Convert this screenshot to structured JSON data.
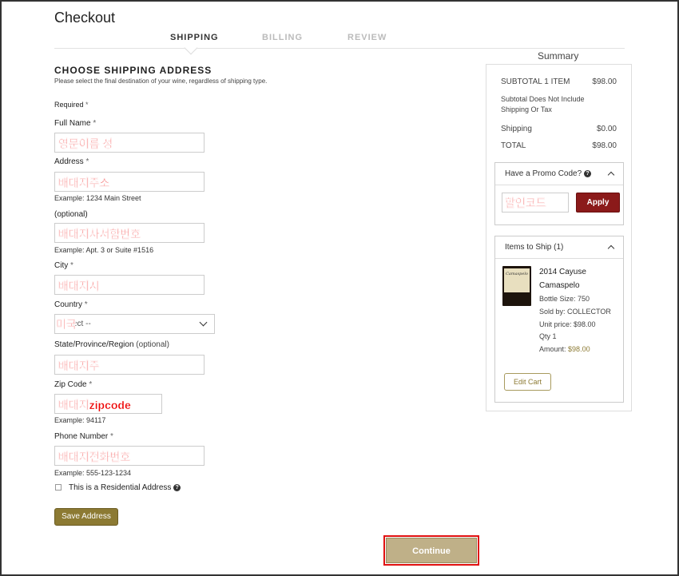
{
  "page": {
    "title": "Checkout"
  },
  "steps": {
    "shipping": "SHIPPING",
    "billing": "BILLING",
    "review": "REVIEW"
  },
  "form": {
    "section_title": "CHOOSE SHIPPING ADDRESS",
    "section_desc": "Please select the final destination of your wine, regardless of shipping type.",
    "required_label": "Required",
    "required_mark": "*",
    "full_name_label": "Full Name",
    "full_name_value": "영문이름 성",
    "address_label": "Address",
    "address_value": "배대지주소",
    "address_hint": "Example: 1234 Main Street",
    "optional_label": "(optional)",
    "address2_value": "배대지사서함번호",
    "address2_hint": "Example: Apt. 3 or Suite #1516",
    "city_label": "City",
    "city_value": "배대지시",
    "country_label": "Country",
    "country_select": "ect --",
    "country_overlay": "미국",
    "state_label": "State/Province/Region",
    "state_optional": "(optional)",
    "state_value": "배대지주",
    "zip_label": "Zip Code",
    "zip_value": "배대지zipcode",
    "zip_hint": "Example: 94117",
    "phone_label": "Phone Number",
    "phone_value": "배대지전화번호",
    "phone_hint": "Example: 555-123-1234",
    "residential_label": "This is a Residential Address",
    "save_button": "Save Address",
    "continue_button": "Continue"
  },
  "summary": {
    "title": "Summary",
    "subtotal_label": "SUBTOTAL 1 ITEM",
    "subtotal_value": "$98.00",
    "note_line1": "Subtotal Does Not Include",
    "note_line2": "Shipping Or Tax",
    "shipping_label": "Shipping",
    "shipping_value": "$0.00",
    "total_label": "TOTAL",
    "total_value": "$98.00",
    "promo_label": "Have a Promo Code?",
    "promo_value": "할인코드",
    "apply_button": "Apply",
    "items_label": "Items to Ship (1)",
    "item": {
      "name_line1": "2014 Cayuse",
      "name_line2": "Camaspelo",
      "bottle_label": "Camaspelo",
      "bottle_size": "Bottle Size: 750",
      "sold_by": "Sold by: COLLECTOR",
      "unit_price": "Unit price: $98.00",
      "qty": "Qty 1",
      "amount_label": "Amount:",
      "amount_value": "$98.00"
    },
    "edit_cart_button": "Edit Cart"
  },
  "colors": {
    "accent_gold": "#8c7a33",
    "apply_red": "#8b1a1a",
    "annotation_red": "#e01010"
  }
}
